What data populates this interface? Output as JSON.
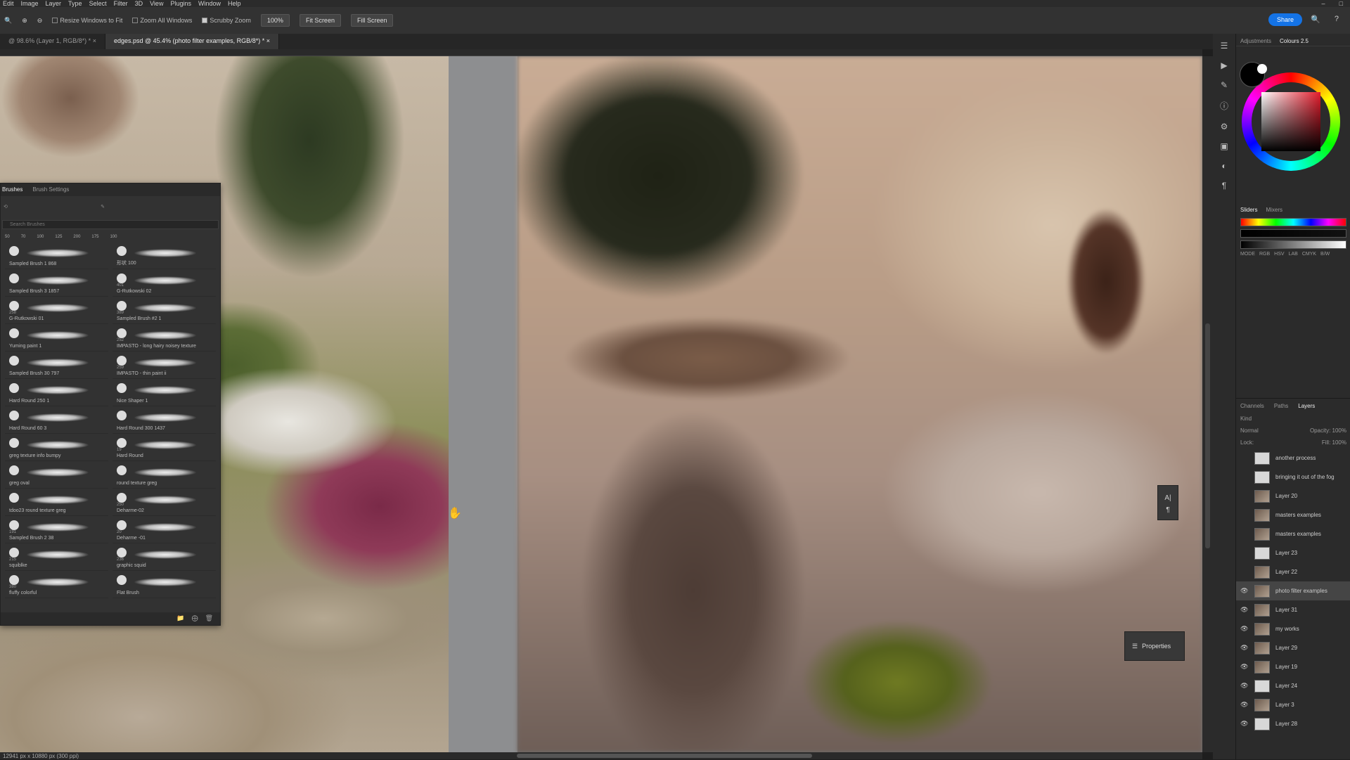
{
  "menu": [
    "Edit",
    "Image",
    "Layer",
    "Type",
    "Select",
    "Filter",
    "3D",
    "View",
    "Plugins",
    "Window",
    "Help"
  ],
  "options": {
    "resize_windows": "Resize Windows to Fit",
    "zoom_all": "Zoom All Windows",
    "scrubby": "Scrubby Zoom",
    "zoom_pct": "100%",
    "fit_screen": "Fit Screen",
    "fill_screen": "Fill Screen",
    "share": "Share"
  },
  "tabs": [
    {
      "label": "@ 98.6% (Layer 1, RGB/8*) *"
    },
    {
      "label": "edges.psd @ 45.4% (photo filter examples, RGB/8*) *"
    }
  ],
  "status": "12941 px x 10880 px (300 ppi)",
  "right_panel": {
    "tabs": [
      "Adjustments",
      "Colours 2.5"
    ],
    "slider_tabs": [
      "Sliders",
      "Mixers"
    ],
    "modes": [
      "MODE",
      "RGB",
      "HSV",
      "LAB",
      "CMYK",
      "B/W"
    ]
  },
  "layers": {
    "tabs": [
      "Channels",
      "Paths",
      "Layers"
    ],
    "kind": "Kind",
    "blend": "Normal",
    "opacity_label": "Opacity:",
    "opacity": "100%",
    "lock_label": "Lock:",
    "fill_label": "Fill:",
    "fill": "100%",
    "items": [
      {
        "name": "another process",
        "visible": false,
        "thumb": "blank"
      },
      {
        "name": "bringing it out of the fog",
        "visible": false,
        "thumb": "blank"
      },
      {
        "name": "Layer 20",
        "visible": false,
        "thumb": "pic"
      },
      {
        "name": "masters examples",
        "visible": false,
        "thumb": "pic"
      },
      {
        "name": "masters examples",
        "visible": false,
        "thumb": "pic"
      },
      {
        "name": "Layer 23",
        "visible": false,
        "thumb": "blank"
      },
      {
        "name": "Layer 22",
        "visible": false,
        "thumb": "pic"
      },
      {
        "name": "photo filter examples",
        "visible": true,
        "thumb": "pic"
      },
      {
        "name": "Layer 31",
        "visible": true,
        "thumb": "pic"
      },
      {
        "name": "my works",
        "visible": true,
        "thumb": "pic"
      },
      {
        "name": "Layer 29",
        "visible": true,
        "thumb": "pic"
      },
      {
        "name": "Layer 19",
        "visible": true,
        "thumb": "pic"
      },
      {
        "name": "Layer 24",
        "visible": true,
        "thumb": "blank"
      },
      {
        "name": "Layer 3",
        "visible": true,
        "thumb": "pic"
      },
      {
        "name": "Layer 28",
        "visible": true,
        "thumb": "blank"
      }
    ]
  },
  "brushes": {
    "tabs": [
      "Brushes",
      "Brush Settings"
    ],
    "search_placeholder": "Search Brushes",
    "presets": [
      "50",
      "70",
      "100",
      "125",
      "200",
      "175",
      "100"
    ],
    "items": [
      {
        "name": "Sampled Brush 1 868",
        "num": ""
      },
      {
        "name": "形状 100",
        "num": ""
      },
      {
        "name": "Sampled Brush 3 1857",
        "num": ""
      },
      {
        "name": "G-Rutkowski 02",
        "num": "401"
      },
      {
        "name": "G-Rutkowski 01",
        "num": "258"
      },
      {
        "name": "Sampled Brush #2 1",
        "num": "389"
      },
      {
        "name": "Yuming paint 1",
        "num": ""
      },
      {
        "name": "IMPASTO - long hairy noisey texture",
        "num": "252"
      },
      {
        "name": "Sampled Brush 30 797",
        "num": ""
      },
      {
        "name": "IMPASTO - thin paint ii",
        "num": "259"
      },
      {
        "name": "Hard Round 250 1",
        "num": ""
      },
      {
        "name": "Nice Shaper 1",
        "num": ""
      },
      {
        "name": "Hard Round 60 3",
        "num": ""
      },
      {
        "name": "Hard Round 300 1437",
        "num": ""
      },
      {
        "name": "greg texture info bumpy",
        "num": ""
      },
      {
        "name": "Hard Round",
        "num": "19"
      },
      {
        "name": "greg oval",
        "num": ""
      },
      {
        "name": "round texture greg",
        "num": ""
      },
      {
        "name": "tdoo23 round texture greg",
        "num": ""
      },
      {
        "name": "Deharme-02",
        "num": "250"
      },
      {
        "name": "Sampled Brush 2 38",
        "num": "191"
      },
      {
        "name": "Deharme -01",
        "num": "20"
      },
      {
        "name": "squiblke",
        "num": "215"
      },
      {
        "name": "graphic squid",
        "num": "236"
      },
      {
        "name": "fluffy colorful",
        "num": "380"
      },
      {
        "name": "Flat Brush",
        "num": ""
      }
    ]
  },
  "properties_label": "Properties"
}
